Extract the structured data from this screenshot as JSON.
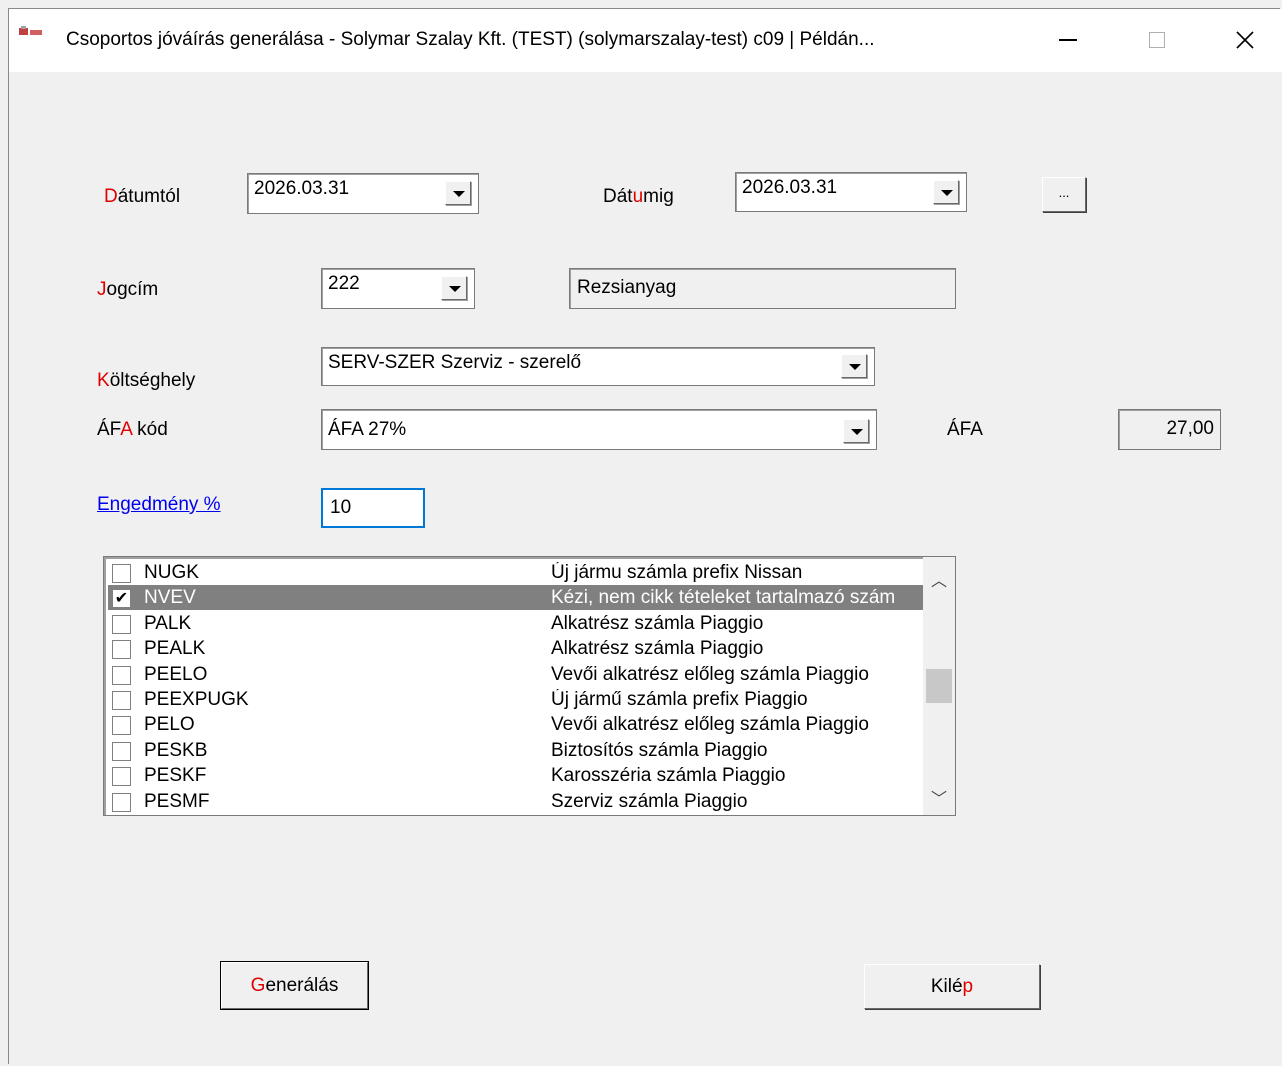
{
  "window": {
    "title": "Csoportos jóváírás generálása - Solymar Szalay Kft. (TEST) (solymarszalay-test)  c09 | Példán...",
    "minimize_symbol": "—",
    "maximize_symbol": "☐",
    "close_symbol": "✕"
  },
  "fields": {
    "datumtol": {
      "label_hot": "D",
      "label_rest": "átumtól",
      "value": "2026.03.31"
    },
    "datumig": {
      "label_pre": "Dát",
      "label_hot": "u",
      "label_rest": "mig",
      "value": "2026.03.31"
    },
    "more_button": "...",
    "jogcim": {
      "label_hot": "J",
      "label_rest": "ogcím",
      "code": "222",
      "name": "Rezsianyag"
    },
    "koltseghely": {
      "label_hot": "K",
      "label_rest": "öltséghely",
      "value": "SERV-SZER Szerviz - szerelő"
    },
    "afa_kod": {
      "label_pre": "ÁF",
      "label_hot": "A",
      "label_rest": " kód",
      "value": "ÁFA 27%"
    },
    "afa": {
      "label": "ÁFA",
      "value": "27,00"
    },
    "engedmeny": {
      "label": "Engedmény %",
      "value": "10"
    }
  },
  "list": {
    "rows": [
      {
        "code": "NUGK",
        "desc": "Új jármu számla prefix Nissan",
        "checked": false,
        "selected": false
      },
      {
        "code": "NVEV",
        "desc": "Kézi, nem cikk tételeket tartalmazó szám",
        "checked": true,
        "selected": true
      },
      {
        "code": "PALK",
        "desc": "Alkatrész számla Piaggio",
        "checked": false,
        "selected": false
      },
      {
        "code": "PEALK",
        "desc": "Alkatrész számla Piaggio",
        "checked": false,
        "selected": false
      },
      {
        "code": "PEELO",
        "desc": "Vevői alkatrész előleg számla Piaggio",
        "checked": false,
        "selected": false
      },
      {
        "code": "PEEXPUGK",
        "desc": "Új jármű számla prefix Piaggio",
        "checked": false,
        "selected": false
      },
      {
        "code": "PELO",
        "desc": "Vevői alkatrész előleg számla Piaggio",
        "checked": false,
        "selected": false
      },
      {
        "code": "PESKB",
        "desc": "Biztosítós számla Piaggio",
        "checked": false,
        "selected": false
      },
      {
        "code": "PESKF",
        "desc": "Karosszéria számla Piaggio",
        "checked": false,
        "selected": false
      },
      {
        "code": "PESMF",
        "desc": "Szerviz számla Piaggio",
        "checked": false,
        "selected": false
      }
    ],
    "scroll_up": "︿",
    "scroll_down": "﹀",
    "check_mark": "✔"
  },
  "buttons": {
    "generalas": {
      "hot": "G",
      "rest": "enerálás"
    },
    "kilep": {
      "pre": "Kilé",
      "hot": "p"
    }
  }
}
